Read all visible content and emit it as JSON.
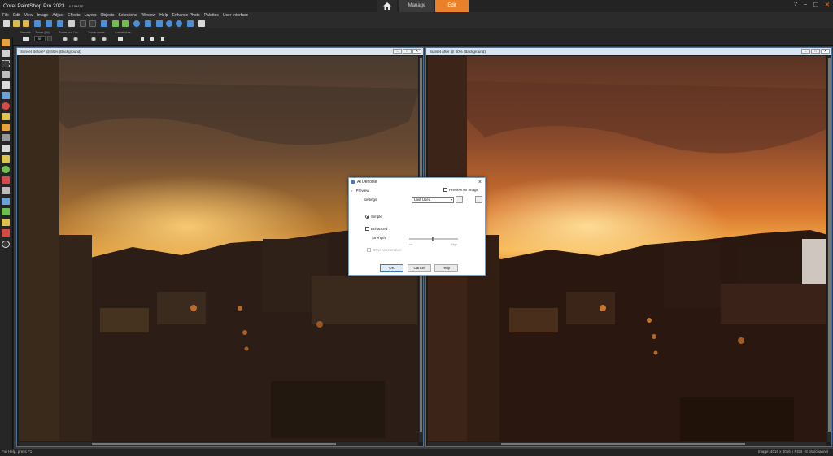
{
  "app": {
    "title": "Corel PaintShop Pro 2023",
    "edition": "ULTIMATE",
    "tabs": {
      "manage": "Manage",
      "edit": "Edit"
    },
    "window_controls": {
      "help": "?",
      "minimize": "–",
      "maximize": "❒",
      "close": "✕"
    }
  },
  "menu": [
    "File",
    "Edit",
    "View",
    "Image",
    "Adjust",
    "Effects",
    "Layers",
    "Objects",
    "Selections",
    "Window",
    "Help",
    "Enhance Photo",
    "Palettes",
    "User Interface"
  ],
  "tool_options": {
    "presets_label": "Presets:",
    "zoom_label": "Zoom (%):",
    "zoom_value": "50",
    "zoom_out_in_label": "Zoom out / in:",
    "zoom_more_label": "Zoom more:",
    "actual_size_label": "Actual size:"
  },
  "windows": {
    "before": {
      "title": "Sunset Before* @  50% (Background)"
    },
    "after": {
      "title": "Sunset After @  50% (Background)"
    }
  },
  "dialog": {
    "title": "AI Denoise",
    "preview_toggle": "Preview",
    "preview_on_image": "Preview on Image",
    "settings_label": "Settings:",
    "settings_value": "Last Used",
    "simple": "Simple",
    "enhanced": "Enhanced",
    "strength_label": "Strength",
    "strength_value": 0.5,
    "tick_low": "Low",
    "tick_high": "High",
    "gpu": "GPU Acceleration",
    "buttons": {
      "ok": "OK",
      "cancel": "Cancel",
      "help": "Help"
    }
  },
  "status": {
    "help": "For Help, press F1",
    "image_info": "Image:  4016 x 4016 x RGB - 8 bits/channel"
  },
  "colors": {
    "accent": "#e8812a",
    "chrome": "#2b2b2b",
    "workspace": "#3b3b3b",
    "window_border": "#4c6f92"
  }
}
